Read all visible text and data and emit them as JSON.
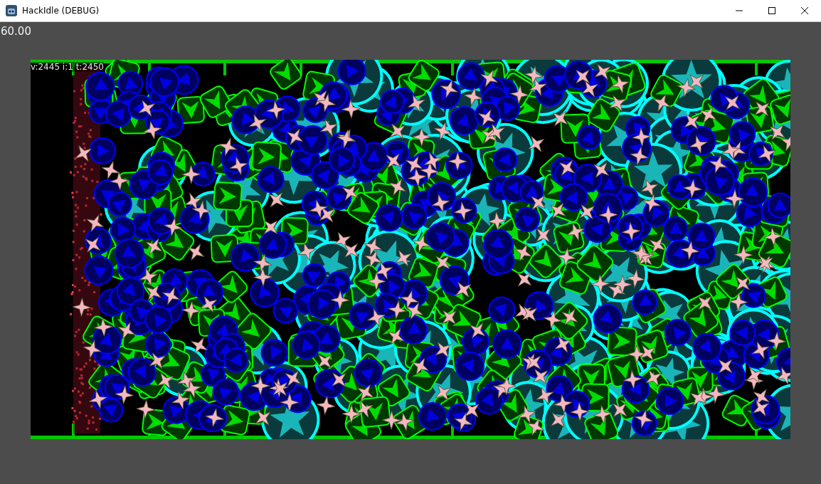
{
  "window": {
    "title": "HackIdle (DEBUG)"
  },
  "fps": "60.00",
  "debug_info": "v:2445 i:1 t:2450"
}
